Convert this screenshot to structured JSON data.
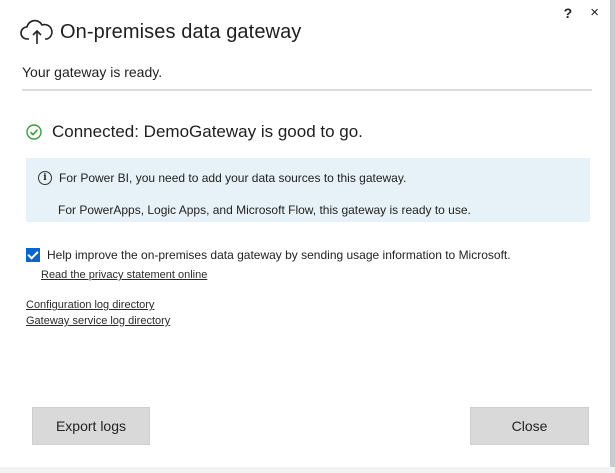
{
  "window": {
    "help_label": "?",
    "close_label": "×"
  },
  "header": {
    "icon": "cloud-upload-icon",
    "title": "On-premises data gateway"
  },
  "subtitle": "Your gateway is ready.",
  "status": {
    "icon": "check-circle-icon",
    "text": "Connected: DemoGateway is good to go.",
    "accent": "#3a9b3a"
  },
  "info": {
    "icon": "info-icon",
    "icon_glyph": "i",
    "line1": "For Power BI, you need to add your data sources to this gateway.",
    "line2": "For PowerApps, Logic Apps, and Microsoft Flow, this gateway is ready to use.",
    "background": "#e6f2f7"
  },
  "consent": {
    "checked": true,
    "label": "Help improve the on-premises data gateway by sending usage information to Microsoft.",
    "privacy_link": "Read the privacy statement online"
  },
  "links": {
    "config_log": "Configuration log directory",
    "service_log": "Gateway service log directory"
  },
  "buttons": {
    "export_logs": "Export logs",
    "close": "Close"
  }
}
